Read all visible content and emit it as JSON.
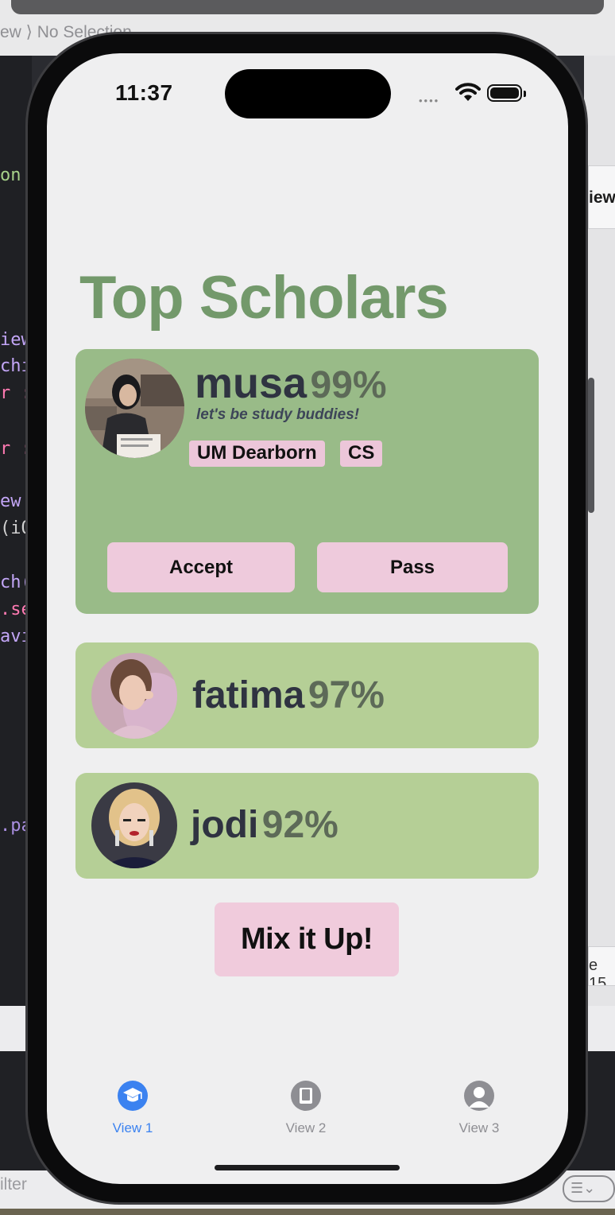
{
  "xcode": {
    "breadcrumb": "ew ⟩ No Selection",
    "code_fragments": [
      "on",
      "iew",
      "chi",
      "r :",
      "r :",
      "ew",
      "(iO",
      "ch(",
      ".se",
      "avi",
      ".pa"
    ],
    "right_panel_label": "iew",
    "right_panel_line": "e 15",
    "filter_placeholder": "ilter"
  },
  "status": {
    "time": "11:37"
  },
  "page": {
    "title": "Top Scholars"
  },
  "featured": {
    "name": "musa",
    "percent": "99%",
    "tagline": "let's be study buddies!",
    "tags": [
      "UM Dearborn",
      "CS"
    ],
    "accept_label": "Accept",
    "pass_label": "Pass"
  },
  "scholars": [
    {
      "name": "fatima",
      "percent": "97%"
    },
    {
      "name": "jodi",
      "percent": "92%"
    }
  ],
  "mix_label": "Mix it Up!",
  "tabs": [
    {
      "label": "View 1",
      "icon": "graduation-cap-icon",
      "active": true
    },
    {
      "label": "View 2",
      "icon": "book-icon",
      "active": false
    },
    {
      "label": "View 3",
      "icon": "person-icon",
      "active": false
    }
  ],
  "colors": {
    "title": "#73996b",
    "featured_card": "#99bb88",
    "card": "#b5cf96",
    "button_pink": "#eecadc",
    "tab_active": "#3b82f0",
    "tab_inactive": "#8e8e93"
  }
}
